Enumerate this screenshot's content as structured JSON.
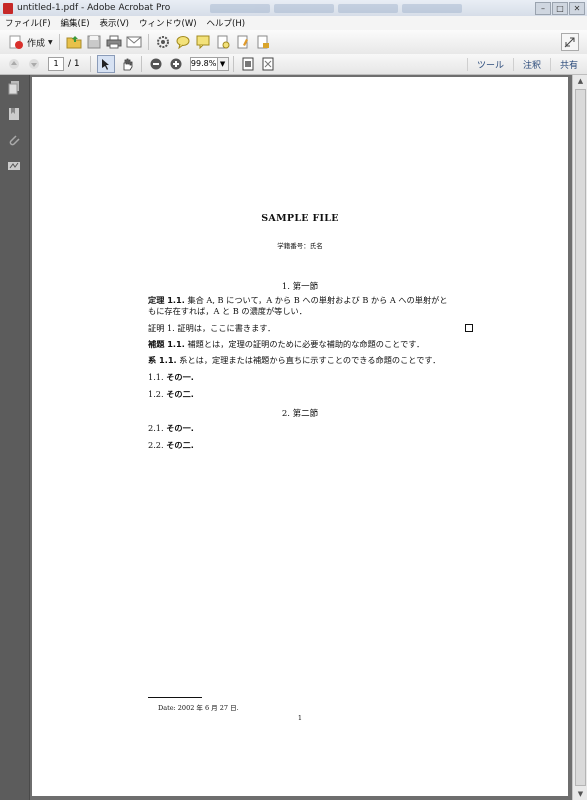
{
  "window": {
    "title": "untitled-1.pdf - Adobe Acrobat Pro"
  },
  "menu": [
    "ファイル(F)",
    "編集(E)",
    "表示(V)",
    "ウィンドウ(W)",
    "ヘルプ(H)"
  ],
  "toolbar": {
    "create_label": "作成"
  },
  "nav": {
    "page_current": "1",
    "page_total": "/ 1",
    "zoom": "99.8%"
  },
  "links": {
    "tools": "ツール",
    "comment": "注釈",
    "share": "共有"
  },
  "doc": {
    "title": "SAMPLE FILE",
    "author": "学籍番号：氏名",
    "section1": "1.  第一節",
    "theorem_head": "定理 1.1.",
    "theorem_line1": "集合 A, B について，A から B への単射および B から A への単射がと",
    "theorem_line2": "もに存在すれば，A と B の濃度が等しい．",
    "proof": "証明 1. 証明は，ここに書きます．",
    "lemma_head": "補題 1.1.",
    "lemma_text": "補題とは，定理の証明のために必要な補助的な命題のことです．",
    "cor_head": "系 1.1.",
    "cor_text": "系とは，定理または補題から直ちに示すことのできる命題のことです．",
    "item11_num": "1.1.",
    "item11_text": "その一.",
    "item12_num": "1.2.",
    "item12_text": "その二.",
    "section2": "2.  第二節",
    "item21_num": "2.1.",
    "item21_text": "その一.",
    "item22_num": "2.2.",
    "item22_text": "その二.",
    "footnote": "Date: 2002 年 6 月 27 日.",
    "page_number": "1"
  }
}
